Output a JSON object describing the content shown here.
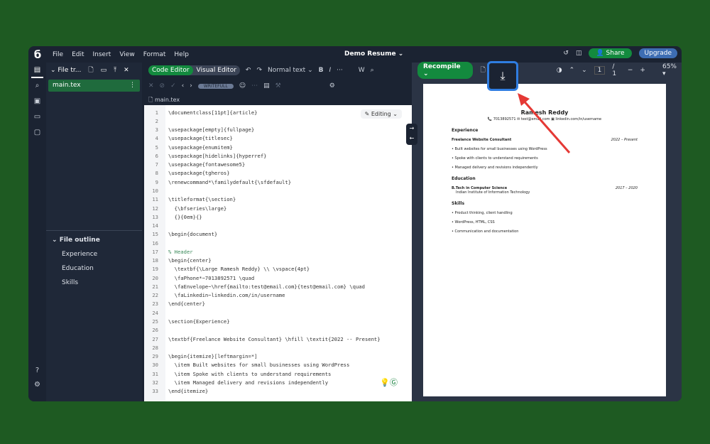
{
  "menubar": {
    "items": [
      "File",
      "Edit",
      "Insert",
      "View",
      "Format",
      "Help"
    ],
    "title": "Demo Resume",
    "share": "Share",
    "upgrade": "Upgrade"
  },
  "tree": {
    "title": "File tr...",
    "file": "main.tex",
    "outline_title": "File outline",
    "outline": [
      "Experience",
      "Education",
      "Skills"
    ]
  },
  "editor": {
    "code_editor": "Code Editor",
    "visual_editor": "Visual Editor",
    "style": "Normal text",
    "bold": "B",
    "italic": "I",
    "more": "···",
    "pill": "WRITEFULL",
    "tab": "main.tex",
    "mode": "Editing",
    "lines": [
      "\\documentclass[11pt]{article}",
      "",
      "\\usepackage[empty]{fullpage}",
      "\\usepackage{titlesec}",
      "\\usepackage{enumitem}",
      "\\usepackage[hidelinks]{hyperref}",
      "\\usepackage{fontawesome5}",
      "\\usepackage{tgheros}",
      "\\renewcommand*\\familydefault{\\sfdefault}",
      "",
      "\\titleformat{\\section}",
      "  {\\bfseries\\large}",
      "  {}{0em}{}",
      "",
      "\\begin{document}",
      "",
      "% Header",
      "\\begin{center}",
      "  \\textbf{\\Large Ramesh Reddy} \\\\ \\vspace{4pt}",
      "  \\faPhone*~7013892571 \\quad",
      "  \\faEnvelope~\\href{mailto:test@email.com}{test@email.com} \\quad",
      "  \\faLinkedin~linkedin.com/in/username",
      "\\end{center}",
      "",
      "\\section{Experience}",
      "",
      "\\textbf{Freelance Website Consultant} \\hfill \\textit{2022 -- Present}",
      "",
      "\\begin{itemize}[leftmargin=*]",
      "  \\item Built websites for small businesses using WordPress",
      "  \\item Spoke with clients to understand requirements",
      "  \\item Managed delivery and revisions independently",
      "\\end{itemize}"
    ]
  },
  "pdf": {
    "recompile": "Recompile",
    "page": "1",
    "pages": "/ 1",
    "zoom": "65%",
    "name": "Ramesh Reddy",
    "contact": "📞 7013892571   ✉ test@email.com   ▣ linkedin.com/in/username",
    "exp_title": "Experience",
    "job": "Freelance Website Consultant",
    "job_dates": "2022 – Present",
    "job_items": [
      "Built websites for small businesses using WordPress",
      "Spoke with clients to understand requirements",
      "Managed delivery and revisions independently"
    ],
    "edu_title": "Education",
    "degree": "B.Tech in Computer Science",
    "degree_dates": "2017 – 2020",
    "school": "Indian Institute of Information Technology",
    "skills_title": "Skills",
    "skills": [
      "Product thinking, client handling",
      "WordPress, HTML, CSS",
      "Communication and documentation"
    ]
  },
  "colors": {
    "accent": "#138a3e",
    "highlight": "#2f7de1",
    "arrow": "#e53935"
  }
}
